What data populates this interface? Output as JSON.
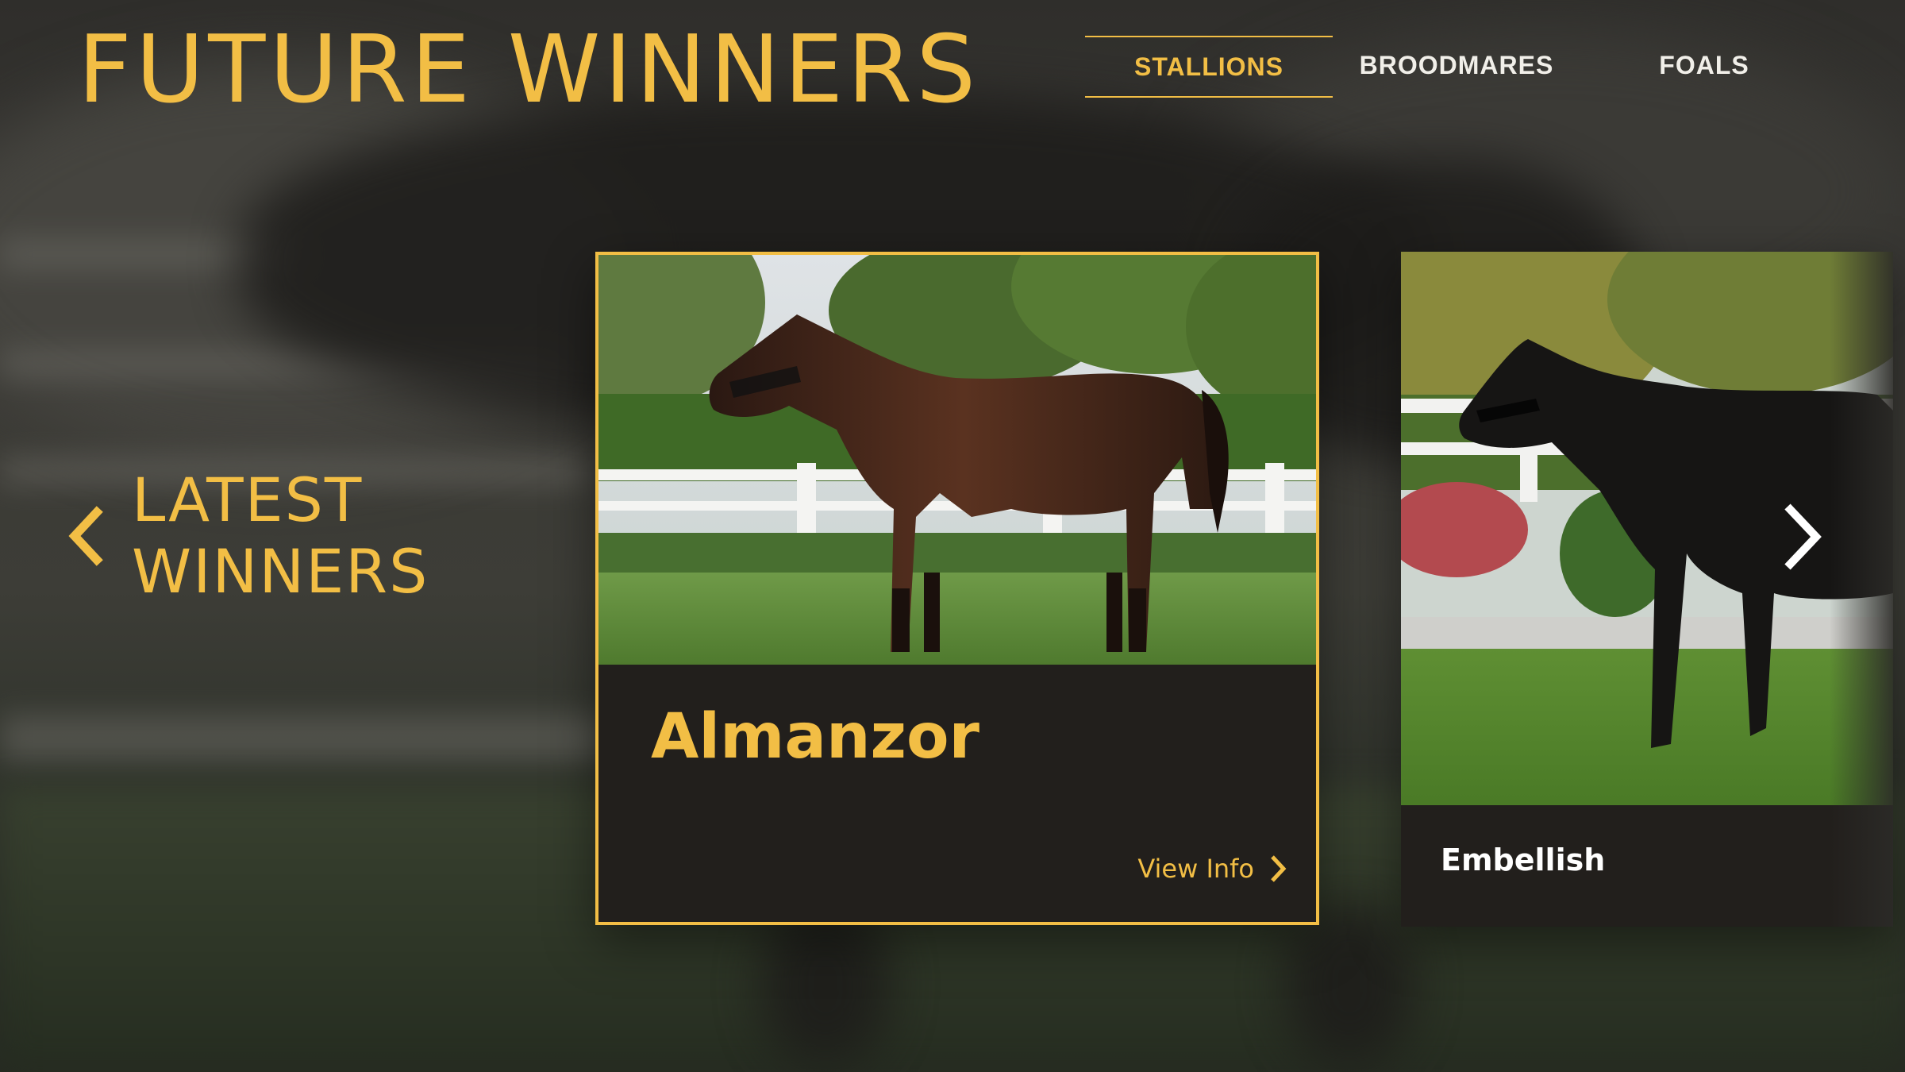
{
  "header": {
    "title": "FUTURE WINNERS"
  },
  "nav": {
    "items": [
      {
        "label": "STALLIONS",
        "active": true
      },
      {
        "label": "BROODMARES",
        "active": false
      },
      {
        "label": "FOALS",
        "active": false
      }
    ]
  },
  "carousel": {
    "prev": {
      "line1": "LATEST",
      "line2": "WINNERS",
      "icon": "chevron-left-icon"
    },
    "next": {
      "icon": "chevron-right-icon"
    },
    "cards": [
      {
        "name": "Almanzor",
        "action_label": "View Info",
        "action_icon": "chevron-right-icon",
        "selected": true
      },
      {
        "name": "Embellish",
        "selected": false
      }
    ]
  },
  "colors": {
    "accent": "#f2be45",
    "card_bg": "#221f1c",
    "text_light": "#f1efe9"
  }
}
